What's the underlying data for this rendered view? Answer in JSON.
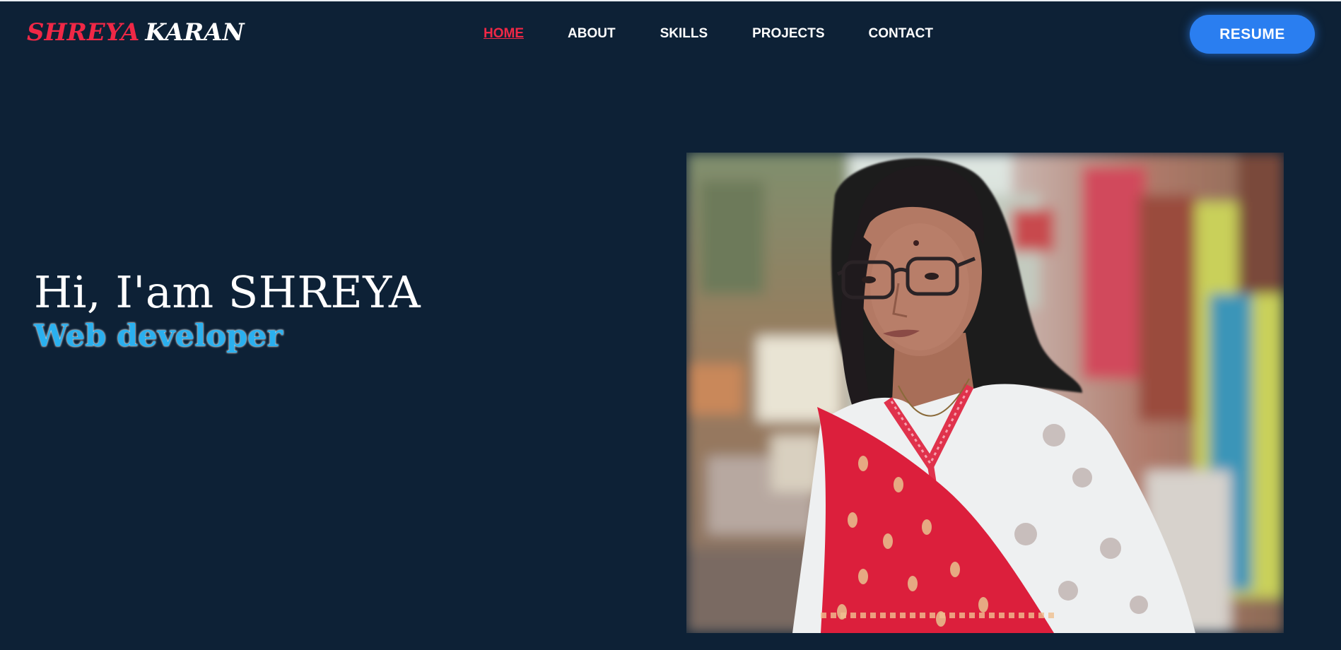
{
  "brand": {
    "first": "SHREYA",
    "last": "KARAN"
  },
  "nav": {
    "items": [
      {
        "label": "HOME",
        "active": true
      },
      {
        "label": "ABOUT",
        "active": false
      },
      {
        "label": "SKILLS",
        "active": false
      },
      {
        "label": "PROJECTS",
        "active": false
      },
      {
        "label": "CONTACT",
        "active": false
      }
    ]
  },
  "header": {
    "resume_label": "RESUME"
  },
  "hero": {
    "greeting": "Hi, I'am SHREYA",
    "role": "Web developer"
  },
  "colors": {
    "background": "#0d2136",
    "accent_red": "#f02846",
    "accent_blue": "#2a7ef0",
    "role_text": "#2ab0ef"
  }
}
